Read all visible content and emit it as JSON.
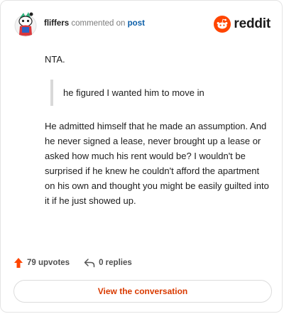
{
  "header": {
    "username": "fliffers",
    "action_text": "commented on",
    "post_link": "post",
    "brand_name": "reddit"
  },
  "comment": {
    "paragraph1": "NTA.",
    "quote": "he figured I wanted him to move in",
    "paragraph2": "He admitted himself that he made an assumption. And he never signed a lease, never brought up a lease or asked how much his rent would be? I wouldn't be surprised if he knew he couldn't afford the apartment on his own and thought you might be easily guilted into it if he just showed up."
  },
  "actions": {
    "upvotes": "79 upvotes",
    "replies": "0 replies"
  },
  "cta": {
    "label": "View the conversation"
  },
  "colors": {
    "brand_orange": "#ff4500",
    "link_blue": "#0b5ea8",
    "cta_text": "#d93a00",
    "upvote": "#ff4500"
  },
  "icons": {
    "avatar": "snoo-avatar-icon",
    "brand": "reddit-logo-icon",
    "upvote": "upvote-arrow-icon",
    "reply": "reply-arrow-icon"
  }
}
